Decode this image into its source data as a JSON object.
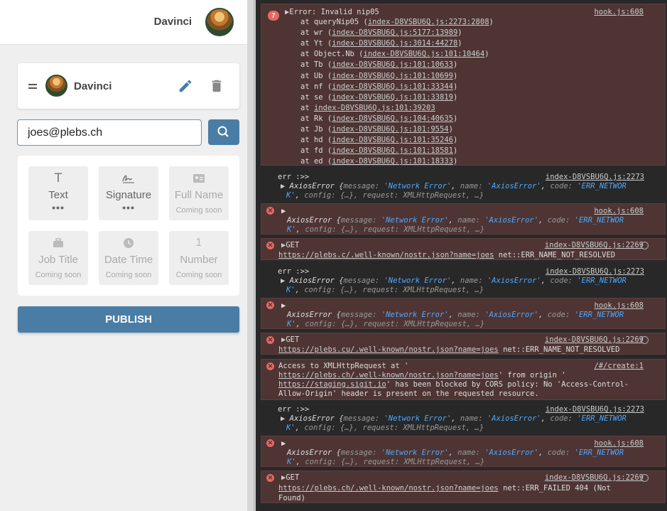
{
  "header": {
    "user_name": "Davinci"
  },
  "signer": {
    "name": "Davinci"
  },
  "search": {
    "value": "joes@plebs.ch"
  },
  "tools": [
    {
      "label": "Text",
      "sub": "•••",
      "disabled": false
    },
    {
      "label": "Signature",
      "sub": "•••",
      "disabled": false
    },
    {
      "label": "Full Name",
      "sub": "Coming soon",
      "disabled": true
    },
    {
      "label": "Job Title",
      "sub": "Coming soon",
      "disabled": true
    },
    {
      "label": "Date Time",
      "sub": "Coming soon",
      "disabled": true
    },
    {
      "label": "Number",
      "sub": "Coming soon",
      "disabled": true
    }
  ],
  "tool_icon_text": {
    "text": "T",
    "number": "1"
  },
  "publish": {
    "label": "PUBLISH"
  },
  "console": {
    "first": {
      "count": "7",
      "title": "Error: Invalid nip05",
      "source": "hook.js:608",
      "stack": [
        {
          "fn": "queryNip05",
          "loc": "index-D8VSBU6Q.js:2273:2808"
        },
        {
          "fn": "wr",
          "loc": "index-D8VSBU6Q.js:5177:13989"
        },
        {
          "fn": "Yt",
          "loc": "index-D8VSBU6Q.js:3014:44278"
        },
        {
          "fn": "Object.Nb",
          "loc": "index-D8VSBU6Q.js:101:10464"
        },
        {
          "fn": "Tb",
          "loc": "index-D8VSBU6Q.js:101:10633"
        },
        {
          "fn": "Ub",
          "loc": "index-D8VSBU6Q.js:101:10699"
        },
        {
          "fn": "nf",
          "loc": "index-D8VSBU6Q.js:101:33344"
        },
        {
          "fn": "se",
          "loc": "index-D8VSBU6Q.js:101:33819"
        },
        {
          "fn": "",
          "loc": "index-D8VSBU6Q.js:101:39203"
        },
        {
          "fn": "Rk",
          "loc": "index-D8VSBU6Q.js:104:40635"
        },
        {
          "fn": "Jb",
          "loc": "index-D8VSBU6Q.js:101:9554"
        },
        {
          "fn": "hd",
          "loc": "index-D8VSBU6Q.js:101:35246"
        },
        {
          "fn": "fd",
          "loc": "index-D8VSBU6Q.js:101:18581"
        },
        {
          "fn": "ed",
          "loc": "index-D8VSBU6Q.js:101:18333"
        }
      ]
    },
    "axios": {
      "err_label": "err :>>",
      "src_index": "index-D8VSBU6Q.js:2273",
      "src_hook": "hook.js:608",
      "name": "AxiosError",
      "message": "'Network Error'",
      "err_name": "'AxiosError'",
      "code_a": "'ERR_NETWOR",
      "code_b": "K'",
      "rest": "config: {…}, request: XMLHttpRequest, …}"
    },
    "gets": [
      {
        "method": "GET",
        "src": "index-D8VSBU6Q.js:2269",
        "url": "https://plebs.c/.well-known/nostr.json?name=joes",
        "status": "net::ERR_NAME_NOT_RESOLVED"
      },
      {
        "method": "GET",
        "src": "index-D8VSBU6Q.js:2269",
        "url": "https://plebs.cu/.well-known/nostr.json?name=joes",
        "status": "net::ERR_NAME_NOT_RESOLVED"
      },
      {
        "method": "GET",
        "src": "index-D8VSBU6Q.js:2269",
        "url": "https://plebs.ch/.well-known/nostr.json?name=joes",
        "status": "net::ERR_FAILED 404 (Not",
        "status2": "Found)"
      }
    ],
    "cors": {
      "src": "/#/create:1",
      "l1": "Access to XMLHttpRequest at '",
      "url1": "https://plebs.ch/.well-known/nostr.json?name=joes",
      "l2": "' from origin '",
      "url2": "https://staging.sigit.io",
      "l3": "' has been blocked by CORS policy: No 'Access-Control-",
      "l4": "Allow-Origin' header is present on the requested resource."
    }
  },
  "colors": {
    "accent": "#4a7da6",
    "error_bg": "#4e3534",
    "console_bg": "#282828",
    "error_icon": "#e46962",
    "string": "#4fa8ff"
  }
}
